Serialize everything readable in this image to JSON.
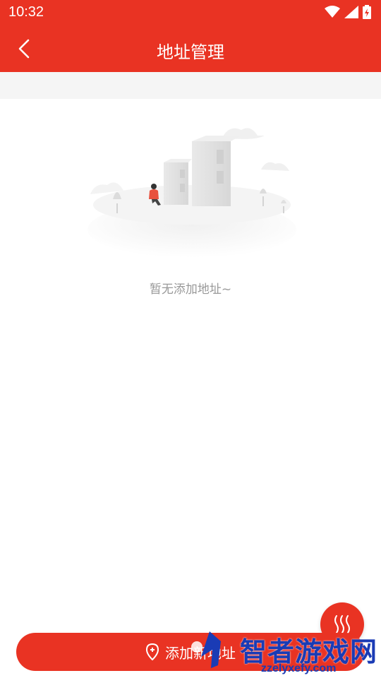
{
  "status_bar": {
    "time": "10:32"
  },
  "header": {
    "title": "地址管理"
  },
  "empty_state": {
    "message": "暂无添加地址~"
  },
  "footer": {
    "add_button_label": "添加新地址"
  },
  "watermark": {
    "main": "智者游戏网",
    "sub": "zzelyxefy.com"
  },
  "colors": {
    "primary": "#e93323",
    "empty_text": "#999999",
    "band": "#f5f5f5"
  }
}
